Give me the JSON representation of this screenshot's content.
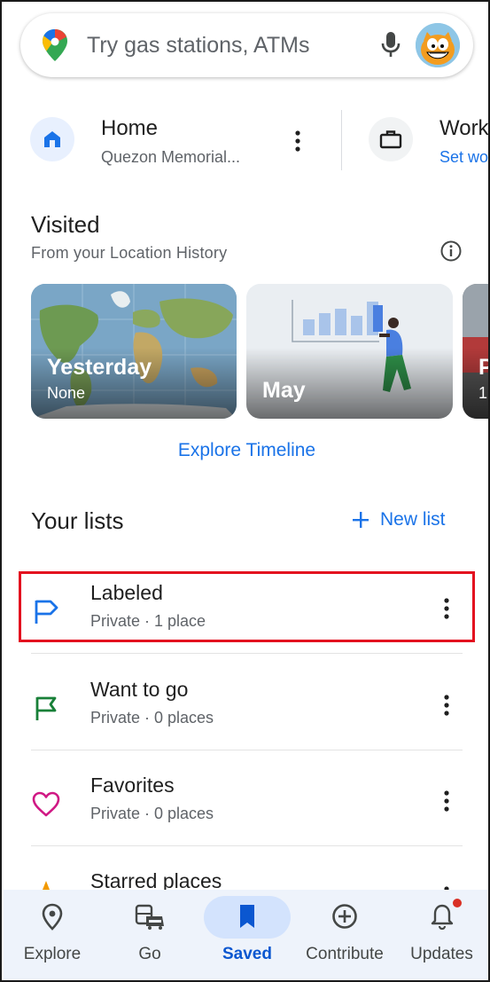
{
  "search": {
    "placeholder": "Try gas stations, ATMs"
  },
  "shortcuts": {
    "home": {
      "title": "Home",
      "subtitle": "Quezon Memorial..."
    },
    "work": {
      "title": "Work",
      "subtitle": "Set wo"
    }
  },
  "visited": {
    "title": "Visited",
    "subtitle": "From your Location History",
    "cards": [
      {
        "title": "Yesterday",
        "subtitle": "None"
      },
      {
        "title": "May",
        "subtitle": ""
      },
      {
        "title": "P",
        "subtitle": "1"
      }
    ],
    "explore_timeline_label": "Explore Timeline"
  },
  "lists": {
    "title": "Your lists",
    "new_list_label": "New list",
    "items": [
      {
        "title": "Labeled",
        "subtitle": "Private · 1 place",
        "icon": "label-flag-icon",
        "color": "#1a73e8"
      },
      {
        "title": "Want to go",
        "subtitle": "Private · 0 places",
        "icon": "flag-icon",
        "color": "#188038"
      },
      {
        "title": "Favorites",
        "subtitle": "Private · 0 places",
        "icon": "heart-icon",
        "color": "#d01884"
      },
      {
        "title": "Starred places",
        "subtitle": "",
        "icon": "star-icon",
        "color": "#f29900"
      }
    ]
  },
  "nav": {
    "items": [
      {
        "label": "Explore",
        "icon": "location-pin-icon"
      },
      {
        "label": "Go",
        "icon": "commute-icon"
      },
      {
        "label": "Saved",
        "icon": "bookmark-icon",
        "selected": true
      },
      {
        "label": "Contribute",
        "icon": "add-circle-icon"
      },
      {
        "label": "Updates",
        "icon": "bell-icon"
      }
    ]
  },
  "colors": {
    "accent": "#1a73e8",
    "highlight_box": "#e3101f",
    "nav_background": "#eef3fb",
    "nav_selected_pill": "#d3e3fd"
  }
}
